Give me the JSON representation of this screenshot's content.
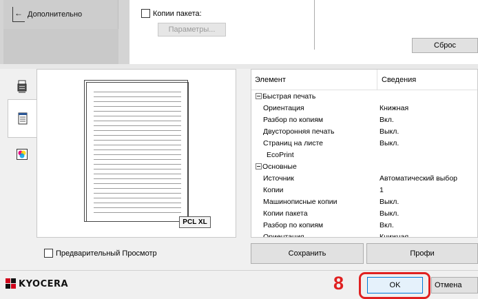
{
  "header": {
    "back_label": "Дополнительно",
    "copies_package_label": "Копии пакета:",
    "copies_package_checked": false,
    "params_button": "Параметры...",
    "reset_button": "Сброс"
  },
  "tabs": [
    {
      "icon": "printer-icon",
      "active": false
    },
    {
      "icon": "document-icon",
      "active": true
    },
    {
      "icon": "color-icon",
      "active": false
    }
  ],
  "preview": {
    "badge": "PCL XL"
  },
  "properties": {
    "col_element": "Элемент",
    "col_info": "Сведения",
    "rows": [
      {
        "type": "group",
        "name": "Быстрая печать",
        "value": ""
      },
      {
        "type": "item",
        "name": "Ориентация",
        "value": "Книжная"
      },
      {
        "type": "item",
        "name": "Разбор по копиям",
        "value": "Вкл."
      },
      {
        "type": "item",
        "name": "Двусторонняя печать",
        "value": "Выкл."
      },
      {
        "type": "item",
        "name": "Страниц на листе",
        "value": "Выкл."
      },
      {
        "type": "plain",
        "name": "EcoPrint",
        "value": ""
      },
      {
        "type": "group",
        "name": "Основные",
        "value": ""
      },
      {
        "type": "item",
        "name": "Источник",
        "value": "Автоматический выбор"
      },
      {
        "type": "item",
        "name": "Копии",
        "value": "1"
      },
      {
        "type": "item",
        "name": "Машинописные копии",
        "value": "Выкл."
      },
      {
        "type": "item",
        "name": "Копии пакета",
        "value": "Выкл."
      },
      {
        "type": "item",
        "name": "Разбор по копиям",
        "value": "Вкл."
      },
      {
        "type": "item",
        "name": "Ориентация",
        "value": "Книжная"
      }
    ]
  },
  "bottom": {
    "preview_checkbox_label": "Предварительный Просмотр",
    "preview_checked": false,
    "save_button": "Сохранить",
    "profi_button": "Профи"
  },
  "footer": {
    "logo_text": "KYOCERA",
    "step_number": "8",
    "ok_button": "OK",
    "cancel_button": "Отмена"
  },
  "colors": {
    "accent_red": "#e02020",
    "ok_border": "#0078d7",
    "logo_red": "#d0021b"
  }
}
